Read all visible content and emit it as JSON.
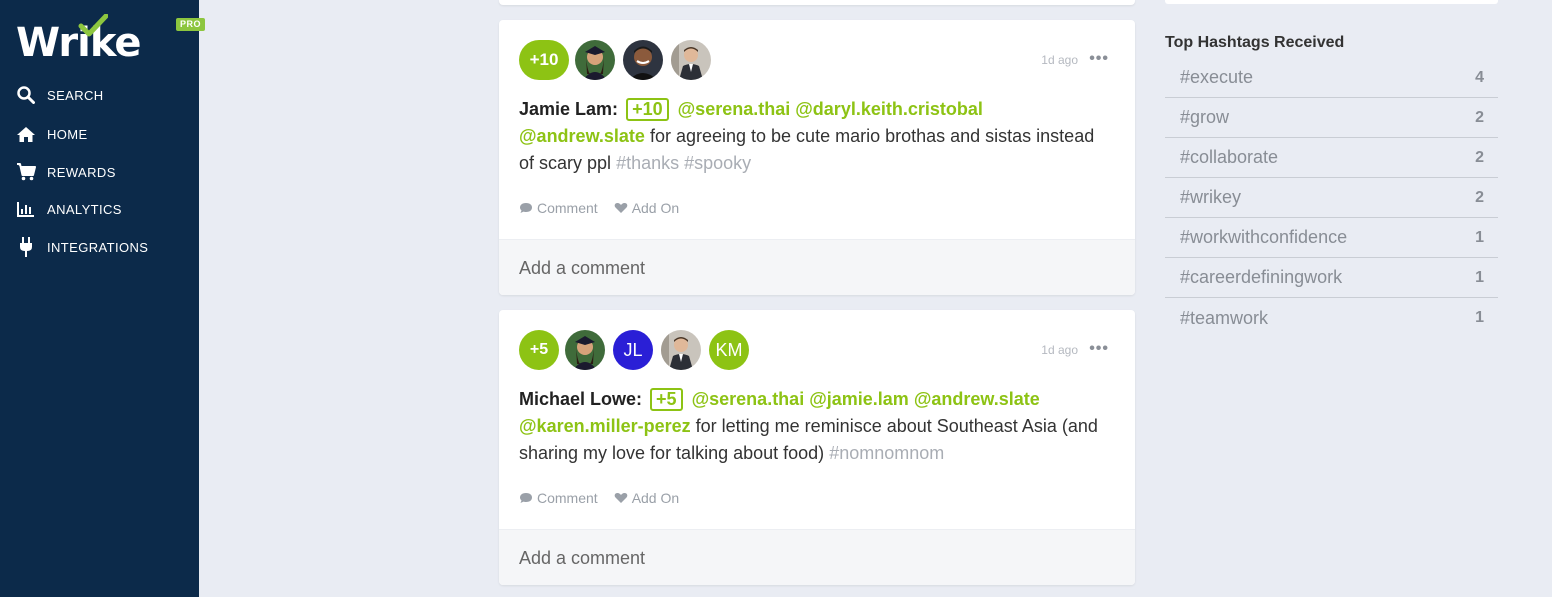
{
  "brand": {
    "logo_text": "Wrike",
    "badge": "PRO"
  },
  "nav": [
    {
      "label": "SEARCH",
      "icon": "search-icon"
    },
    {
      "label": "HOME",
      "icon": "home-icon"
    },
    {
      "label": "REWARDS",
      "icon": "cart-icon"
    },
    {
      "label": "ANALYTICS",
      "icon": "bar-chart-icon"
    },
    {
      "label": "INTEGRATIONS",
      "icon": "plug-icon"
    }
  ],
  "posts": [
    {
      "points": "+10",
      "time": "1d ago",
      "author": "Jamie Lam:",
      "points_tag": "+10",
      "mentions": [
        "@serena.thai",
        "@daryl.keith.cristobal",
        "@andrew.slate"
      ],
      "text": "for agreeing to be cute mario brothas and sistas instead of scary ppl",
      "hashtags": [
        "#thanks",
        "#spooky"
      ],
      "recipients": [
        {
          "type": "photo",
          "name": "serena-thai"
        },
        {
          "type": "photo",
          "name": "daryl-keith-cristobal"
        },
        {
          "type": "photo",
          "name": "andrew-slate"
        }
      ],
      "comment_label": "Comment",
      "addon_label": "Add On",
      "comment_placeholder": "Add a comment"
    },
    {
      "points": "+5",
      "time": "1d ago",
      "author": "Michael Lowe:",
      "points_tag": "+5",
      "mentions": [
        "@serena.thai",
        "@jamie.lam",
        "@andrew.slate",
        "@karen.miller-perez"
      ],
      "text": "for letting me reminisce about Southeast Asia (and sharing my love for talking about food)",
      "hashtags": [
        "#nomnomnom"
      ],
      "recipients": [
        {
          "type": "photo",
          "name": "serena-thai"
        },
        {
          "type": "initials",
          "initials": "JL",
          "color": "#2a1fd6"
        },
        {
          "type": "photo",
          "name": "andrew-slate"
        },
        {
          "type": "initials",
          "initials": "KM",
          "color": "#8dc314"
        }
      ],
      "comment_label": "Comment",
      "addon_label": "Add On",
      "comment_placeholder": "Add a comment"
    }
  ],
  "hashtags_panel": {
    "title": "Top Hashtags Received",
    "items": [
      {
        "tag": "#execute",
        "count": "4"
      },
      {
        "tag": "#grow",
        "count": "2"
      },
      {
        "tag": "#collaborate",
        "count": "2"
      },
      {
        "tag": "#wrikey",
        "count": "2"
      },
      {
        "tag": "#workwithconfidence",
        "count": "1"
      },
      {
        "tag": "#careerdefiningwork",
        "count": "1"
      },
      {
        "tag": "#teamwork",
        "count": "1"
      }
    ]
  },
  "colors": {
    "sidebar": "#0c2a4a",
    "accent": "#8dc314",
    "background": "#e9ecf3"
  }
}
